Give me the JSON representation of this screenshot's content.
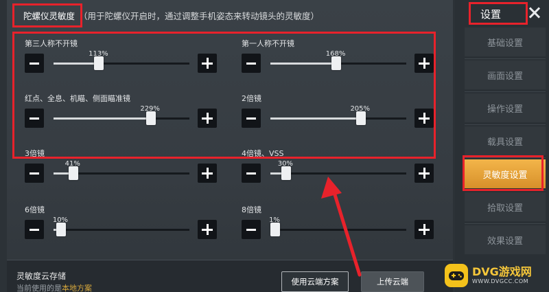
{
  "gyro_header": {
    "title": "陀螺仪灵敏度",
    "description": "（用于陀螺仪开启时，通过调整手机姿态来转动镜头的灵敏度）"
  },
  "sliders": [
    {
      "label": "第三人称不开镜",
      "value": "113%",
      "percent": 0.3
    },
    {
      "label": "第一人称不开镜",
      "value": "168%",
      "percent": 0.45
    },
    {
      "label": "红点、全息、机瞄、侧面瞄准镜",
      "value": "229%",
      "percent": 0.68
    },
    {
      "label": "2倍镜",
      "value": "205%",
      "percent": 0.63
    },
    {
      "label": "3倍镜",
      "value": "41%",
      "percent": 0.11
    },
    {
      "label": "4倍镜、VSS",
      "value": "30%",
      "percent": 0.08
    },
    {
      "label": "6倍镜",
      "value": "10%",
      "percent": 0.02
    },
    {
      "label": "8倍镜",
      "value": "1%",
      "percent": 0.0
    }
  ],
  "cloud": {
    "title": "灵敏度云存储",
    "subtitle_prefix": "当前使用的是",
    "subtitle_highlight": "本地方案",
    "use_cloud_label": "使用云端方案",
    "upload_label": "上传云端"
  },
  "settings_panel": {
    "title": "设置",
    "menu": [
      {
        "label": "基础设置",
        "active": false
      },
      {
        "label": "画面设置",
        "active": false
      },
      {
        "label": "操作设置",
        "active": false
      },
      {
        "label": "载具设置",
        "active": false
      },
      {
        "label": "灵敏度设置",
        "active": true
      },
      {
        "label": "拾取设置",
        "active": false
      },
      {
        "label": "效果设置",
        "active": false
      }
    ]
  },
  "watermark": {
    "name": "DVG游戏网",
    "url": "WWW.DVGCC.COM"
  },
  "colors": {
    "highlight_red": "#e8222b",
    "active_menu": "#f3b54a",
    "watermark_yellow": "#f4c21b"
  }
}
